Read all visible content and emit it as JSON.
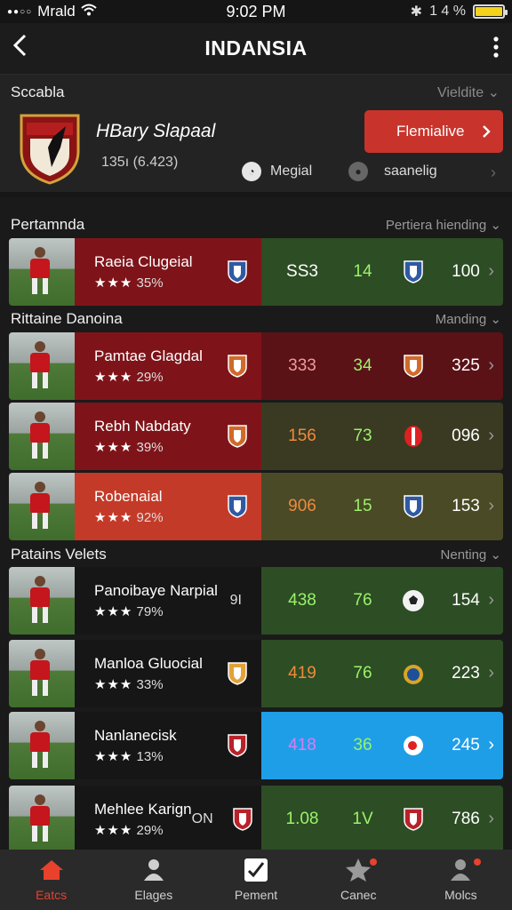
{
  "status": {
    "carrier": "Mrald",
    "time": "9:02 PM",
    "battery": "1 4 %"
  },
  "nav": {
    "title": "INDANSIA"
  },
  "featured": {
    "label": "Sccabla",
    "link": "Vieldite",
    "name": "HBary Slapaal",
    "stats": "135ı  (6.423)",
    "button": "Flemialive",
    "chip1": "Megial",
    "chip2": "saanelig"
  },
  "sections": [
    {
      "title": "Pertamnda",
      "filter": "Pertiera hiending"
    },
    {
      "title": "Rittaine Danoina",
      "filter": "Manding"
    },
    {
      "title": "Patains Velets",
      "filter": "Nenting"
    }
  ],
  "rows": [
    {
      "name": "Raeia Clugeial",
      "stars": "★★★",
      "rating": "35%",
      "extra": "",
      "s1": "SS3",
      "s2": "14",
      "s3": "100",
      "s1_color": "#ffffff",
      "info_bg": "#7e1419",
      "stats_bg": "#2d4d24",
      "badge_color": "#2f5aa3",
      "icon": "badge"
    },
    {
      "name": "Pamtae Glagdal",
      "stars": "★★★",
      "rating": "29%",
      "extra": "",
      "s1": "333",
      "s2": "34",
      "s3": "325",
      "s1_color": "#f19a9a",
      "info_bg": "#7e1419",
      "stats_bg": "#5a1216",
      "badge_color": "#d06a2a",
      "icon": "badge"
    },
    {
      "name": "Rebh Nabdaty",
      "stars": "★★★",
      "rating": "39%",
      "extra": "",
      "s1": "156",
      "s2": "73",
      "s3": "096",
      "s1_color": "#f08a3c",
      "info_bg": "#7e1419",
      "stats_bg": "#3a3a22",
      "badge_color": "#d06a2a",
      "icon": "oval"
    },
    {
      "name": "Robenaial",
      "stars": "★★★",
      "rating": "92%",
      "extra": "",
      "s1": "906",
      "s2": "15",
      "s3": "153",
      "s1_color": "#f08a3c",
      "info_bg": "#c43a28",
      "stats_bg": "#4a4a26",
      "badge_color": "#2f5aa3",
      "icon": "badge"
    },
    {
      "name": "Panoibaye Narpial",
      "stars": "★★★",
      "rating": "79%",
      "extra": "9I",
      "s1": "438",
      "s2": "76",
      "s3": "154",
      "s1_color": "#9af36b",
      "info_bg": "#161616",
      "stats_bg": "#2d4d24",
      "badge_color": "",
      "icon": "ball"
    },
    {
      "name": "Manloa Gluocial",
      "stars": "★★★",
      "rating": "33%",
      "extra": "",
      "s1": "419",
      "s2": "76",
      "s3": "223",
      "s1_color": "#f08a3c",
      "info_bg": "#161616",
      "stats_bg": "#2d4d24",
      "badge_color": "#e2a23a",
      "icon": "coin"
    },
    {
      "name": "Nanlanecisk",
      "stars": "★★★",
      "rating": "13%",
      "extra": "",
      "s1": "418",
      "s2": "36",
      "s3": "245",
      "s1_color": "#d67ff0",
      "info_bg": "#161616",
      "stats_bg": "#1f9ee8",
      "badge_color": "#b8222a",
      "icon": "ring"
    },
    {
      "name": "Mehlee Karign",
      "stars": "★★★",
      "rating": "29%",
      "extra": "ON",
      "s1": "1.08",
      "s2": "1V",
      "s3": "786",
      "s1_color": "#9af36b",
      "info_bg": "#161616",
      "stats_bg": "#2d4d24",
      "badge_color": "#b8222a",
      "icon": "badge"
    }
  ],
  "tabs": [
    {
      "label": "Eatcs"
    },
    {
      "label": "Elages"
    },
    {
      "label": "Pement"
    },
    {
      "label": "Canec"
    },
    {
      "label": "Molcs"
    }
  ],
  "colors": {
    "accent": "#e8412c",
    "button": "#c8342b",
    "highlight": "#1f9ee8"
  }
}
